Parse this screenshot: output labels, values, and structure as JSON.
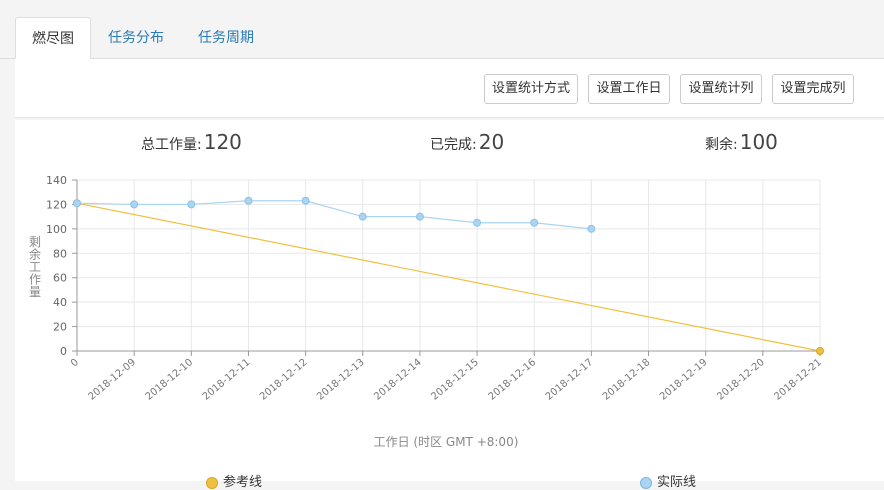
{
  "tabs": [
    {
      "label": "燃尽图",
      "active": true
    },
    {
      "label": "任务分布",
      "active": false
    },
    {
      "label": "任务周期",
      "active": false
    }
  ],
  "toolbar": {
    "btn_stat_mode": "设置统计方式",
    "btn_workday": "设置工作日",
    "btn_stat_column": "设置统计列",
    "btn_done_column": "设置完成列"
  },
  "stats": {
    "total_label": "总工作量:",
    "total_value": "120",
    "done_label": "已完成:",
    "done_value": "20",
    "remain_label": "剩余:",
    "remain_value": "100"
  },
  "chart_data": {
    "type": "line",
    "categories": [
      "0",
      "2018-12-09",
      "2018-12-10",
      "2018-12-11",
      "2018-12-12",
      "2018-12-13",
      "2018-12-14",
      "2018-12-15",
      "2018-12-16",
      "2018-12-17",
      "2018-12-18",
      "2018-12-19",
      "2018-12-20",
      "2018-12-21"
    ],
    "series": [
      {
        "name": "参考线",
        "color": "#f0c040",
        "points": [
          [
            0,
            121
          ],
          [
            13,
            0
          ]
        ]
      },
      {
        "name": "实际线",
        "color": "#a9d4f2",
        "values": [
          121,
          120,
          120,
          123,
          123,
          110,
          110,
          105,
          105,
          100
        ]
      }
    ],
    "xlabel": "工作日 (时区 GMT +8:00)",
    "ylabel": "剩余工作量",
    "ylim": [
      0,
      140
    ],
    "yticks": [
      0,
      20,
      40,
      60,
      80,
      100,
      120,
      140
    ],
    "grid": true,
    "legend_position": "bottom"
  }
}
